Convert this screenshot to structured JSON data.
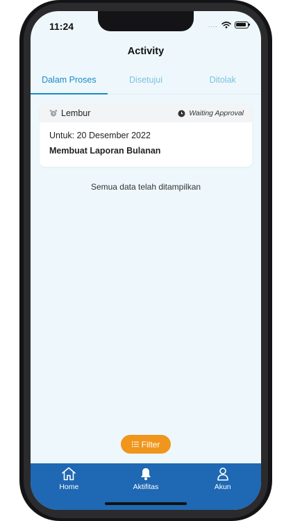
{
  "status_bar": {
    "time": "11:24",
    "signal": "....",
    "wifi_icon": "wifi-icon",
    "battery_icon": "battery-icon"
  },
  "header": {
    "title": "Activity"
  },
  "tabs": [
    {
      "label": "Dalam Proses",
      "active": true
    },
    {
      "label": "Disetujui",
      "active": false
    },
    {
      "label": "Ditolak",
      "active": false
    }
  ],
  "card": {
    "type_icon": "alarm-clock-icon",
    "type_label": "Lembur",
    "status_icon": "clock-icon",
    "status": "Waiting Approval",
    "date": "Untuk: 20 Desember 2022",
    "description": "Membuat Laporan Bulanan"
  },
  "info": "Semua data telah ditampilkan",
  "filter": {
    "icon": "list-icon",
    "label": "Filter"
  },
  "bottom_nav": [
    {
      "icon": "home-icon",
      "label": "Home"
    },
    {
      "icon": "bell-icon",
      "label": "Aktifitas"
    },
    {
      "icon": "user-icon",
      "label": "Akun"
    }
  ],
  "colors": {
    "screen_bg": "#eef8fc",
    "accent": "#1b8ac4",
    "tab_inactive": "#7cc0e2",
    "filter_button": "#f0961d",
    "bottom_nav_bg": "#1f68b3"
  }
}
